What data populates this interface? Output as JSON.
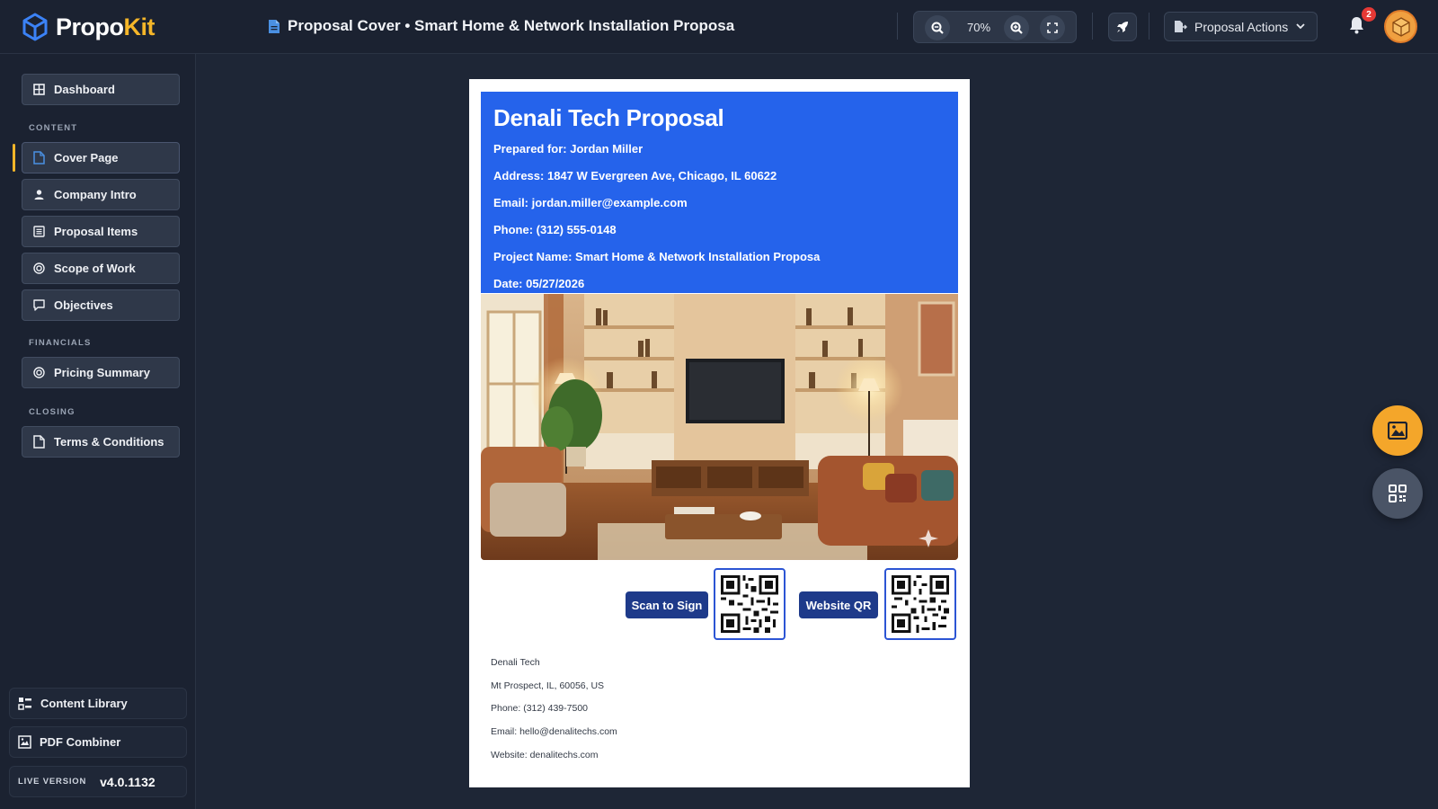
{
  "app": {
    "logo_prefix": "Propo",
    "logo_suffix": "Kit",
    "document_title": "Proposal Cover • Smart Home & Network Installation Proposa"
  },
  "toolbar": {
    "zoom_level": "70%",
    "proposal_actions_label": "Proposal Actions",
    "notification_count": "2"
  },
  "sidebar": {
    "dashboard_label": "Dashboard",
    "sections": {
      "content": "CONTENT",
      "financials": "FINANCIALS",
      "closing": "CLOSING"
    },
    "items": [
      {
        "label": "Cover Page",
        "icon": "file-icon",
        "active": true
      },
      {
        "label": "Company Intro",
        "icon": "person-icon",
        "active": false
      },
      {
        "label": "Proposal Items",
        "icon": "list-icon",
        "active": false
      },
      {
        "label": "Scope of Work",
        "icon": "target-icon",
        "active": false
      },
      {
        "label": "Objectives",
        "icon": "comment-icon",
        "active": false
      },
      {
        "label": "Pricing Summary",
        "icon": "target-icon",
        "active": false
      },
      {
        "label": "Terms & Conditions",
        "icon": "file-icon",
        "active": false
      }
    ],
    "bottom": {
      "content_library": "Content Library",
      "pdf_combiner": "PDF Combiner",
      "live_version_label": "LIVE VERSION",
      "live_version_value": "v4.0.1132"
    }
  },
  "cover": {
    "title": "Denali Tech Proposal",
    "prepared_for": "Prepared for: Jordan Miller",
    "address": "Address: 1847 W Evergreen Ave, Chicago, IL 60622",
    "email": "Email: jordan.miller@example.com",
    "phone": "Phone: (312) 555-0148",
    "project_name": "Project Name: Smart Home & Network Installation Proposa",
    "date": "Date: 05/27/2026",
    "scan_to_sign_label": "Scan to Sign",
    "website_qr_label": "Website QR",
    "company": {
      "name": "Denali Tech",
      "address": "Mt Prospect, IL, 60056, US",
      "phone": "Phone: (312) 439-7500",
      "email": "Email: hello@denalitechs.com",
      "website": "Website: denalitechs.com"
    }
  },
  "colors": {
    "accent": "#f5b629",
    "cover_blue": "#2563eb",
    "qr_button": "#1e3a8a",
    "fab_image": "#f4a62a"
  }
}
